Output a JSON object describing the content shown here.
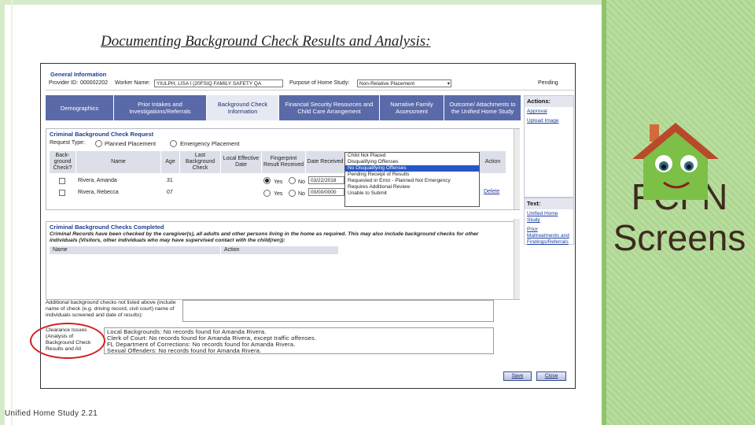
{
  "slide": {
    "title": "Documenting Background Check Results and Analysis:",
    "footer": "Unified Home Study 2.21",
    "side_text": "FCFN Screens",
    "colors": {
      "frame": "#d6ebc9",
      "panel": "#a9d48c",
      "tab": "#5a6aa9",
      "highlight": "#d11e1e"
    }
  },
  "app": {
    "general_info": {
      "title": "General Information",
      "provider_label": "Provider ID:",
      "provider_value": "000002202",
      "worker_label": "Worker Name:",
      "worker_value": "YIULPH, LISA I (20FSIQ FAMILY SAFETY QA",
      "purpose_label": "Purpose of Home Study:",
      "purpose_value": "Non-Relative Placement",
      "status": "Pending"
    },
    "tabs": [
      {
        "label": "Demographics"
      },
      {
        "label": "Prior Intakes and Investigations/Referrals"
      },
      {
        "label": "Background Check Information"
      },
      {
        "label": "Financial Security Resources and Child Care Arrangement"
      },
      {
        "label": "Narrative Family Assessment"
      },
      {
        "label": "Outcome/ Attachments to the Unified Home Study"
      }
    ],
    "actions": {
      "title": "Actions:",
      "links": [
        "Approval",
        "Upload Image"
      ]
    },
    "text_panel": {
      "title": "Text:",
      "links": [
        "Unified Home Study",
        "Prior Maltreatments and Findings/Referrals"
      ]
    },
    "cbr": {
      "title": "Criminal Background Check Request",
      "request_type_label": "Request Type:",
      "option_planned": "Planned Placement",
      "option_emergency": "Emergency Placement",
      "columns": [
        "Back-ground Check?",
        "Name",
        "Age",
        "Last Background Check",
        "Local Effective Date",
        "Fingerprint Result Received",
        "Date Received",
        "Action"
      ],
      "rows": [
        {
          "name": "Rivera, Amanda",
          "age": "31",
          "yes": "Yes",
          "no": "No",
          "date": "03/22/2018",
          "action": ""
        },
        {
          "name": "Rivera, Rebecca",
          "age": "07",
          "yes": "Yes",
          "no": "No",
          "date": "00/00/0000",
          "action": "Delete"
        }
      ],
      "dropdown_options": [
        "Child Not Placed",
        "Disqualifying Offenses",
        "No Disqualifying Offenses",
        "Pending Receipt of Results",
        "Requested in Error - Planned Not Emergency",
        "Requires Additional Review",
        "Unable to Submit"
      ],
      "dropdown_selected_index": 2
    },
    "cbc": {
      "title": "Criminal Background Checks Completed",
      "description": "Criminal Records have been checked by the caregiver(s), all adults and other persons living in the home as required. This may also include background checks for other individuals (Visitors, other individuals who may have supervised contact with the child(ren)):",
      "columns": [
        "Name",
        "Action"
      ]
    },
    "additional": {
      "label": "Additional background checks not listed above (include name of check (e.g. driving record, civil court) name of individuals screened and date of results):"
    },
    "clearance": {
      "label": "Clearance Issues (Analysis of Background Check Results and All",
      "lines": [
        "Local Backgrounds: No records found for Amanda Rivera.",
        "Clerk of Court: No records found for Amanda Rivera, except traffic offenses.",
        "FL Department of Corrections: No records found for Amanda Rivera.",
        "Sexual Offenders: No records found for Amanda Rivera."
      ]
    },
    "buttons": {
      "save": "Save",
      "close": "Close"
    }
  }
}
